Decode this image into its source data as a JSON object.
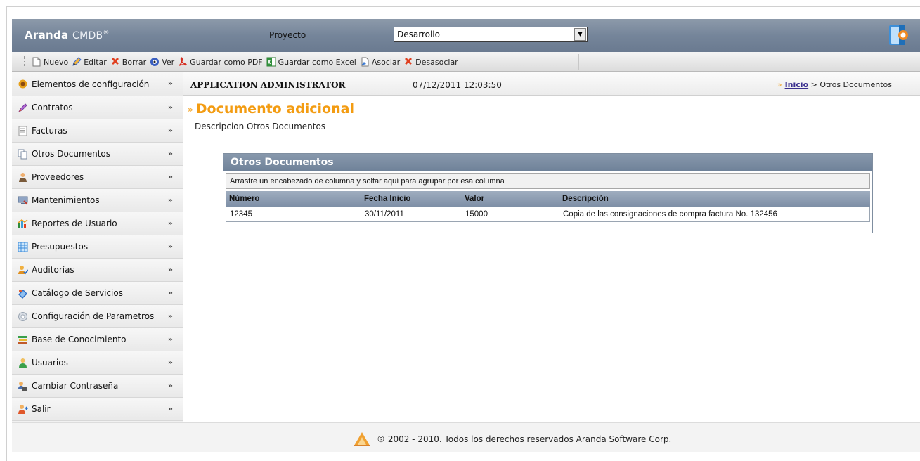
{
  "header": {
    "brand": "Aranda",
    "product": "CMDB",
    "reg_mark": "®",
    "project_label": "Proyecto",
    "project_value": "Desarrollo"
  },
  "toolbar": {
    "items": [
      {
        "label": "Nuevo",
        "icon": "new-document-icon"
      },
      {
        "label": "Editar",
        "icon": "pencil-icon"
      },
      {
        "label": "Borrar",
        "icon": "delete-x-icon"
      },
      {
        "label": "Ver",
        "icon": "eye-icon"
      },
      {
        "label": "Guardar como PDF",
        "icon": "pdf-icon"
      },
      {
        "label": "Guardar como Excel",
        "icon": "excel-icon"
      },
      {
        "label": "Asociar",
        "icon": "associate-icon"
      },
      {
        "label": "Desasociar",
        "icon": "dissociate-x-icon"
      }
    ]
  },
  "sidebar": {
    "items": [
      {
        "label": "Elementos de configuración",
        "icon": "config-elements-icon"
      },
      {
        "label": "Contratos",
        "icon": "contract-pen-icon"
      },
      {
        "label": "Facturas",
        "icon": "invoice-icon"
      },
      {
        "label": "Otros Documentos",
        "icon": "documents-icon"
      },
      {
        "label": "Proveedores",
        "icon": "provider-icon"
      },
      {
        "label": "Mantenimientos",
        "icon": "maintenance-icon"
      },
      {
        "label": "Reportes de Usuario",
        "icon": "reports-icon"
      },
      {
        "label": "Presupuestos",
        "icon": "budget-icon"
      },
      {
        "label": "Auditorías",
        "icon": "audit-icon"
      },
      {
        "label": "Catálogo de Servicios",
        "icon": "service-catalog-icon"
      },
      {
        "label": "Configuración de Parametros",
        "icon": "settings-gear-icon"
      },
      {
        "label": "Base de Conocimiento",
        "icon": "knowledge-base-icon"
      },
      {
        "label": "Usuarios",
        "icon": "users-icon"
      },
      {
        "label": "Cambiar Contraseña",
        "icon": "change-password-icon"
      },
      {
        "label": "Salir",
        "icon": "exit-icon"
      }
    ],
    "chevron": "»"
  },
  "info": {
    "user": "APPLICATION ADMINISTRATOR",
    "datetime": "07/12/2011 12:03:50",
    "crumb_marker": "»",
    "crumb_home": "Inicio",
    "crumb_rest": " > Otros Documentos"
  },
  "page": {
    "title": "Documento adicional",
    "title_marker": "»",
    "subtitle": "Descripcion Otros Documentos"
  },
  "grid": {
    "title": "Otros Documentos",
    "group_hint": "Arrastre un encabezado de columna y soltar aquí para agrupar por esa columna",
    "columns": [
      "Número",
      "Fecha Inicio",
      "Valor",
      "Descripción"
    ],
    "rows": [
      [
        "12345",
        "30/11/2011",
        "15000",
        "Copia de las consignaciones de compra factura No. 132456"
      ]
    ]
  },
  "footer": {
    "text": "® 2002 - 2010. Todos los derechos reservados Aranda Software Corp."
  },
  "colors": {
    "header_bg": "#75859a",
    "title_orange": "#f39c12",
    "grid_header_bg": "#8898ac"
  }
}
